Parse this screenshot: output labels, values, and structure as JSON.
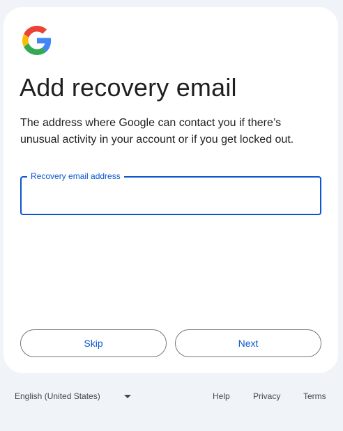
{
  "card": {
    "logo": "google-g-logo",
    "title": "Add recovery email",
    "description": "The address where Google can contact you if there’s unusual activity in your account or if you get locked out.",
    "field": {
      "label": "Recovery email address",
      "value": ""
    },
    "buttons": {
      "skip": "Skip",
      "next": "Next"
    }
  },
  "footer": {
    "language": "English (United States)",
    "language_icon": "dropdown-arrow-icon",
    "links": {
      "help": "Help",
      "privacy": "Privacy",
      "terms": "Terms"
    }
  },
  "colors": {
    "accent": "#0b57d0",
    "page_background": "#f0f4f9",
    "card_background": "#ffffff",
    "google_blue": "#4285F4",
    "google_red": "#EA4335",
    "google_yellow": "#FBBC05",
    "google_green": "#34A853"
  }
}
